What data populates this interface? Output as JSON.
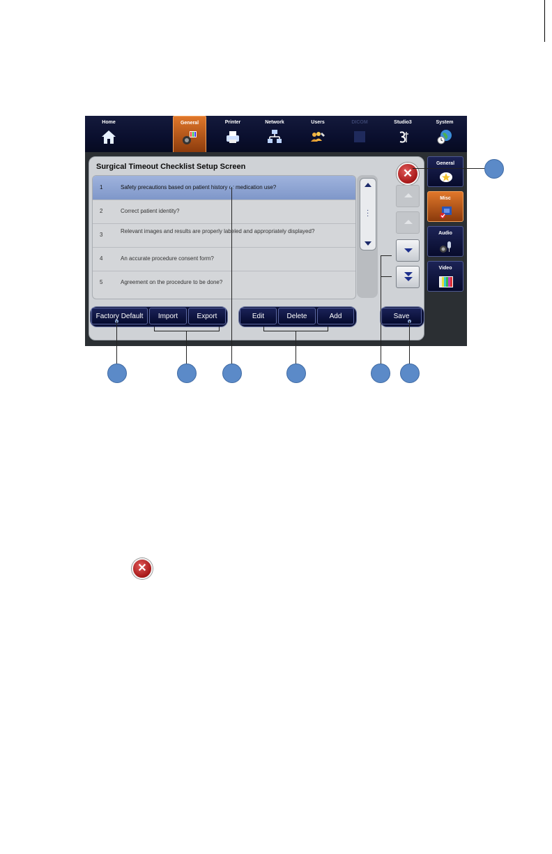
{
  "nav": [
    {
      "label": "Home",
      "icon": "home-icon",
      "state": "normal"
    },
    {
      "label": "General",
      "icon": "general-settings-icon",
      "state": "active"
    },
    {
      "label": "Printer",
      "icon": "printer-icon",
      "state": "normal"
    },
    {
      "label": "Network",
      "icon": "network-icon",
      "state": "normal"
    },
    {
      "label": "Users",
      "icon": "users-icon",
      "state": "normal"
    },
    {
      "label": "DICOM",
      "icon": "dicom-icon",
      "state": "disabled"
    },
    {
      "label": "Studio3",
      "icon": "studio3-icon",
      "state": "normal"
    },
    {
      "label": "System",
      "icon": "system-globe-icon",
      "state": "normal"
    }
  ],
  "panel": {
    "title": "Surgical Timeout Checklist Setup Screen"
  },
  "checklist": [
    {
      "num": "1",
      "text": "Safety precautions based on patient history or medication use?"
    },
    {
      "num": "2",
      "text": "Correct patient identity?"
    },
    {
      "num": "3",
      "text": "Relevant images and results are properly labeled and appropriately displayed?"
    },
    {
      "num": "4",
      "text": "An accurate procedure consent form?"
    },
    {
      "num": "5",
      "text": "Agreement on the procedure to be done?"
    }
  ],
  "buttons": {
    "factory_default": "Factory Default",
    "import": "Import",
    "export": "Export",
    "edit": "Edit",
    "delete": "Delete",
    "add": "Add",
    "save": "Save"
  },
  "side_tabs": [
    {
      "label": "General",
      "icon": "star-icon"
    },
    {
      "label": "Misc",
      "icon": "checklist-icon"
    },
    {
      "label": "Audio",
      "icon": "microphone-icon"
    },
    {
      "label": "Video",
      "icon": "color-bars-icon"
    }
  ],
  "colors": {
    "accent": "#e0772a",
    "nav_bg": "#0a0f2e",
    "selected_row": "#8fa5d3",
    "callout": "#5b8ac8",
    "close": "#b51f1f"
  }
}
